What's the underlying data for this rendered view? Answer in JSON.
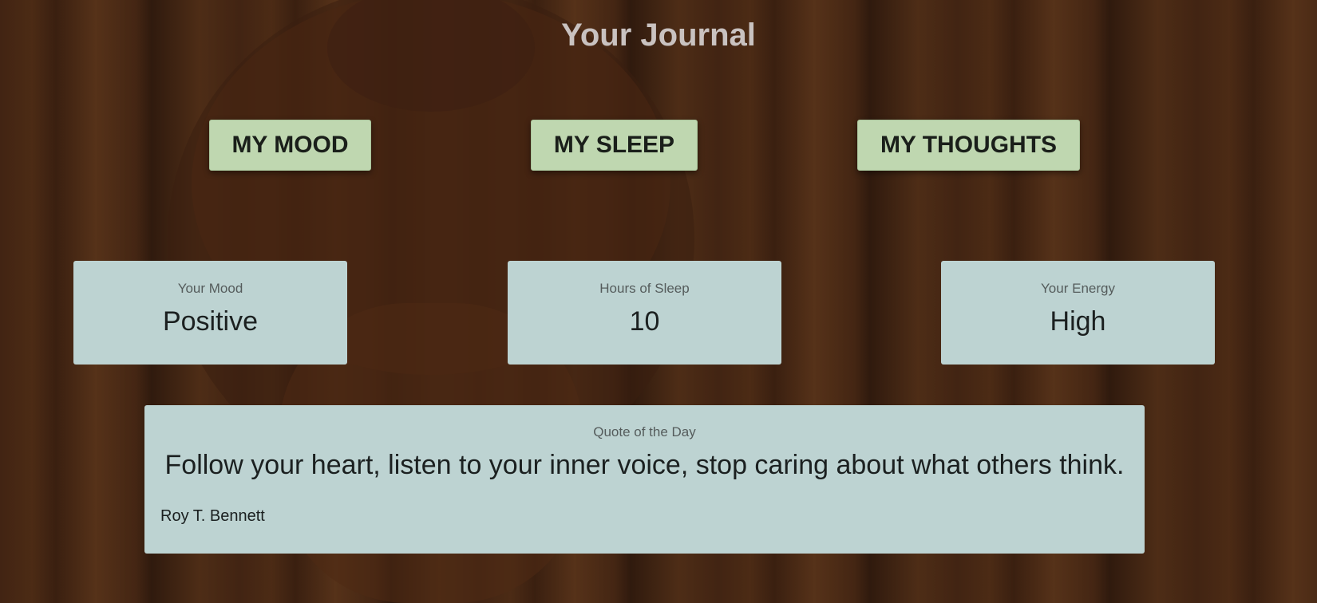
{
  "header": {
    "title": "Your Journal"
  },
  "nav": {
    "mood_label": "MY MOOD",
    "sleep_label": "MY SLEEP",
    "thoughts_label": "MY THOUGHTS"
  },
  "stats": {
    "mood": {
      "label": "Your Mood",
      "value": "Positive"
    },
    "sleep": {
      "label": "Hours of Sleep",
      "value": "10"
    },
    "energy": {
      "label": "Your Energy",
      "value": "High"
    }
  },
  "quote": {
    "label": "Quote of the Day",
    "text": "Follow your heart, listen to your inner voice, stop caring about what others think.",
    "author": "Roy T. Bennett"
  },
  "colors": {
    "button_bg": "#bfd7b0",
    "card_bg": "#bdd3d2",
    "title_color": "#c9c2c0",
    "background": "#6a3a1e"
  }
}
